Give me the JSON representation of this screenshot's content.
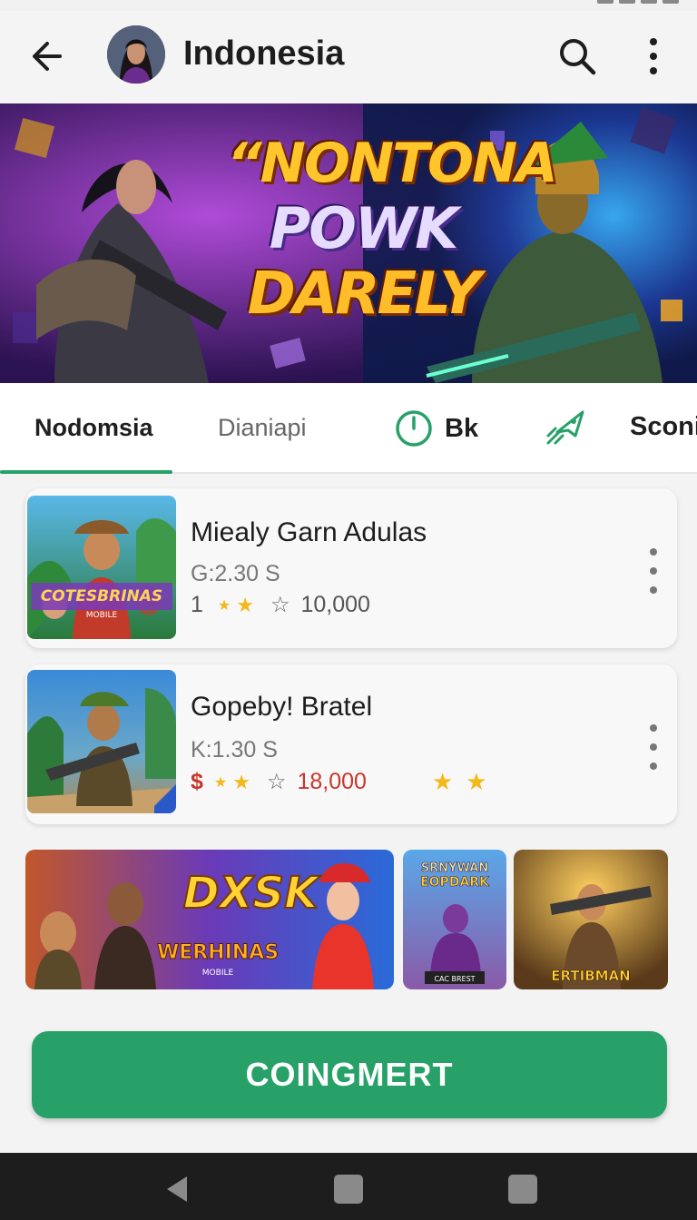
{
  "app_bar": {
    "title": "Indonesia",
    "back_icon": "arrow-left-icon",
    "search_icon": "search-icon",
    "more_icon": "more-vertical-icon"
  },
  "banner": {
    "line1": "“NONTONA",
    "line2": "POWK",
    "line3": "DARELY"
  },
  "tabs": [
    {
      "label": "Nodomsia",
      "active": true
    },
    {
      "label": "Dianiapi",
      "active": false
    },
    {
      "label": "Bk",
      "icon": "timer-icon",
      "active": false
    },
    {
      "label": "Sconi",
      "icon": "rocket-icon",
      "active": false
    }
  ],
  "games": [
    {
      "name": "Miealy Garn Adulas",
      "price": "G:2.30 S",
      "rating_prefix": "1",
      "count": "10,000",
      "thumb_text": "COTESBRINAS",
      "thumb_subtext": "MOBILE"
    },
    {
      "name": "Gopeby! Bratel",
      "price": "K:1.30 S",
      "rating_prefix": "$",
      "count": "18,000"
    }
  ],
  "promos": [
    {
      "title": "DXSK",
      "subtitle": "WERHINAS",
      "tag": "MOBILE"
    },
    {
      "title": "SRNYWAN",
      "subtitle": "EOPDARK",
      "tag": "CAC BREST"
    },
    {
      "title": "ERTIBMAN"
    }
  ],
  "cta": {
    "label": "COINGMERT"
  },
  "colors": {
    "accent": "#27a168",
    "star": "#f3b918",
    "price_red": "#c8362a"
  }
}
